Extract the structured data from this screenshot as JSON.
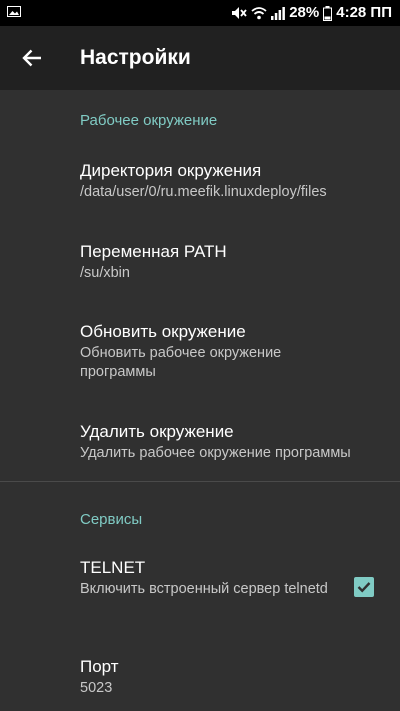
{
  "status_bar": {
    "battery": "28%",
    "time": "4:28 ПП"
  },
  "app_bar": {
    "title": "Настройки"
  },
  "sections": [
    {
      "header": "Рабочее окружение",
      "items": [
        {
          "title": "Директория окружения",
          "summary": "/data/user/0/ru.meefik.linuxdeploy/files"
        },
        {
          "title": "Переменная PATH",
          "summary": "/su/xbin"
        },
        {
          "title": "Обновить окружение",
          "summary": "Обновить рабочее окружение программы"
        },
        {
          "title": "Удалить окружение",
          "summary": "Удалить рабочее окружение программы"
        }
      ]
    },
    {
      "header": "Сервисы",
      "items": [
        {
          "title": "TELNET",
          "summary": "Включить встроенный сервер telnetd",
          "checked": true
        },
        {
          "title": "Порт",
          "summary": "5023"
        }
      ]
    }
  ],
  "colors": {
    "accent": "#80cbc4",
    "background": "#303030",
    "app_bar": "#212121"
  }
}
